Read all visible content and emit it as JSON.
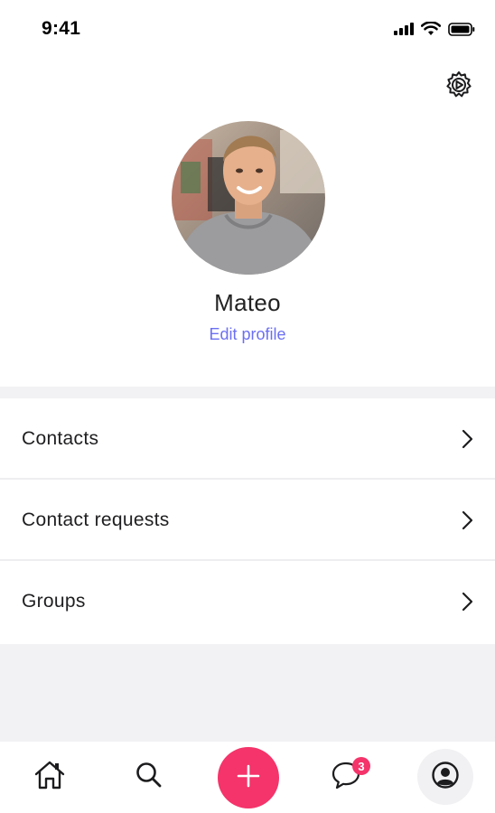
{
  "status_bar": {
    "time": "9:41",
    "icons": [
      "cellular-signal-icon",
      "wifi-icon",
      "battery-icon"
    ]
  },
  "header": {
    "settings_icon": "settings-gear-icon"
  },
  "profile": {
    "name": "Mateo",
    "edit_label": "Edit profile",
    "avatar": "profile-photo"
  },
  "menu": {
    "items": [
      {
        "label": "Contacts"
      },
      {
        "label": "Contact requests"
      },
      {
        "label": "Groups"
      }
    ]
  },
  "tab_bar": {
    "items": [
      "home-icon",
      "search-icon",
      "add-icon",
      "chat-icon",
      "profile-icon"
    ],
    "chat_badge": "3"
  },
  "colors": {
    "accent": "#f4346a",
    "link": "#6c6ff2",
    "divider": "#f2f2f4"
  }
}
